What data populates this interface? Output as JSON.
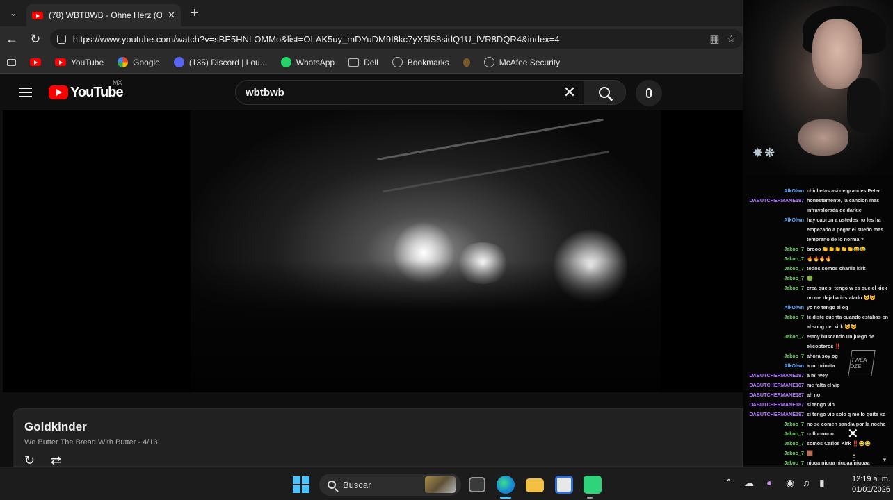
{
  "browser": {
    "tab_title": "(78) WBTBWB - Ohne Herz (Official",
    "url": "https://www.youtube.com/watch?v=sBE5HNLOMMo&list=OLAK5uy_mDYuDM9I8kc7yX5lS8sidQ1U_fVR8DQR4&index=4",
    "bookmarks": [
      {
        "label": "YouTube",
        "icon": "youtube-icon",
        "color": "#ff0000"
      },
      {
        "label": "Google",
        "icon": "google-icon",
        "color": "#4285f4"
      },
      {
        "label": "(135) Discord | Lou...",
        "icon": "discord-icon",
        "color": "#5865f2"
      },
      {
        "label": "WhatsApp",
        "icon": "whatsapp-icon",
        "color": "#25d366"
      },
      {
        "label": "Dell",
        "icon": "folder-icon",
        "color": "#bbbbbb"
      },
      {
        "label": "Bookmarks",
        "icon": "globe-icon",
        "color": "#bbbbbb"
      },
      {
        "label": "McAfee Security",
        "icon": "globe-icon",
        "color": "#bbbbbb"
      }
    ]
  },
  "youtube": {
    "logo_text": "YouTube",
    "country_code": "MX",
    "search_value": "wbtbwb"
  },
  "miniplayer": {
    "title": "Goldkinder",
    "subtitle": "We Butter The Bread With Butter - 4/13"
  },
  "chat": {
    "messages": [
      {
        "user": "AlkOlwn",
        "color": "blue",
        "text": "chichetas asi de grandes Peter"
      },
      {
        "user": "DABUTCHERMANE187",
        "color": "purple",
        "text": "honestamente, la cancion mas infravalorada de darkie"
      },
      {
        "user": "AlkOlwn",
        "color": "blue",
        "text": "hay cabron a ustedes no les ha empezado a pegar el sueño mas temprano de lo normal?"
      },
      {
        "user": "Jakoo_7",
        "color": "green",
        "text": "brooo 👏👏👏👏👏😂😂"
      },
      {
        "user": "Jakoo_7",
        "color": "green",
        "text": "🔥🔥🔥🔥"
      },
      {
        "user": "Jakoo_7",
        "color": "green",
        "text": "todos somos charlie kirk"
      },
      {
        "user": "Jakoo_7",
        "color": "green",
        "text": "🟢"
      },
      {
        "user": "Jakoo_7",
        "color": "green",
        "text": "crea que si tengo w es que el kick no me dejaba instalado 😺😺"
      },
      {
        "user": "AlkOlwn",
        "color": "blue",
        "text": "yo no tengo el og"
      },
      {
        "user": "Jakoo_7",
        "color": "green",
        "text": "te diste cuenta cuando estabas en al song del kirk 😺😺"
      },
      {
        "user": "Jakoo_7",
        "color": "green",
        "text": "estoy buscando un juego de elicopteros ‼️"
      },
      {
        "user": "Jakoo_7",
        "color": "green",
        "text": "ahora soy og"
      },
      {
        "user": "AlkOlwn",
        "color": "blue",
        "text": "a mi primita"
      },
      {
        "user": "DABUTCHERMANE187",
        "color": "purple",
        "text": "a mi wey"
      },
      {
        "user": "DABUTCHERMANE187",
        "color": "purple",
        "text": "me falta el vip"
      },
      {
        "user": "DABUTCHERMANE187",
        "color": "purple",
        "text": "ah no"
      },
      {
        "user": "DABUTCHERMANE187",
        "color": "purple",
        "text": "si tengo vip"
      },
      {
        "user": "DABUTCHERMANE187",
        "color": "purple",
        "text": "si tengo vip solo q me lo quite xd"
      },
      {
        "user": "Jakoo_7",
        "color": "green",
        "text": "no se comen sandia por la noche"
      },
      {
        "user": "Jakoo_7",
        "color": "green",
        "text": "colloooooo"
      },
      {
        "user": "Jakoo_7",
        "color": "green",
        "text": "somos Carlos Kirk ‼️😂😂"
      },
      {
        "user": "Jakoo_7",
        "color": "green",
        "text": "🟫"
      },
      {
        "user": "Jakoo_7",
        "color": "green",
        "text": "nigga nigga niggaa niggaa"
      },
      {
        "user": "Jakoo_7",
        "color": "green",
        "text": "‼️‼️ 😂"
      }
    ],
    "logo_text": "TWEA DZE"
  },
  "taskbar": {
    "search_placeholder": "Buscar",
    "time": "12:19 a. m.",
    "date": "01/01/2026"
  }
}
